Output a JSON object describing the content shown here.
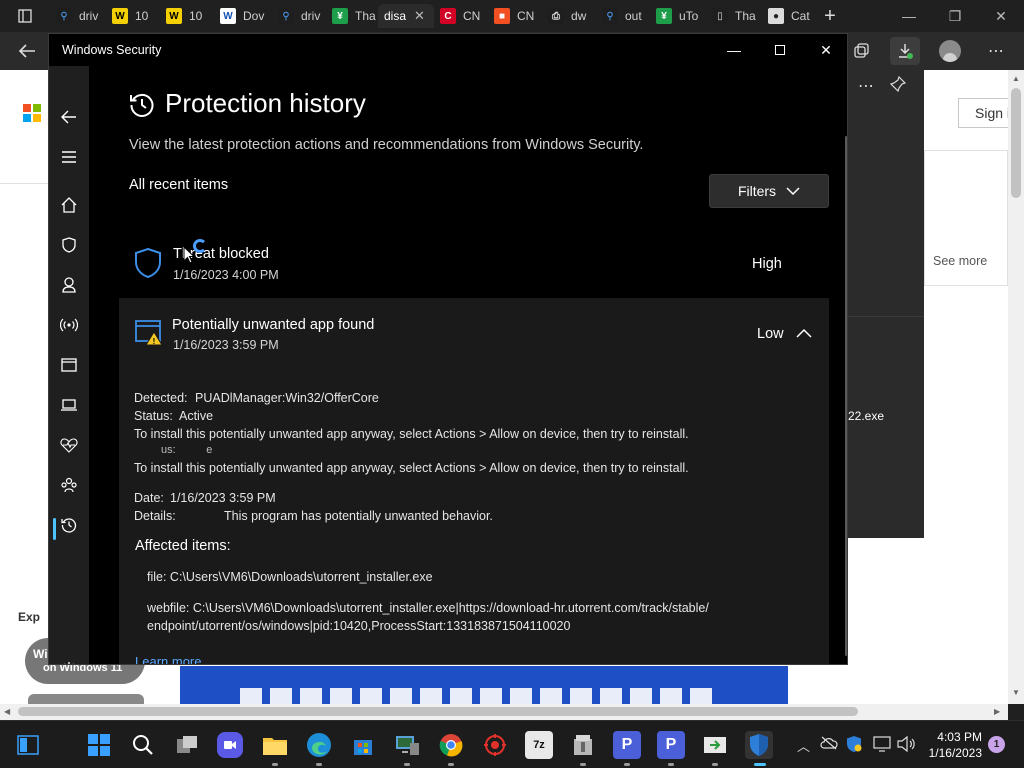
{
  "browser": {
    "tabs": [
      {
        "label": "driv",
        "icon": "search-icon",
        "fav_bg": "#1e1e1e",
        "fav_fg": "#4da3ff",
        "fav_text": "⚲"
      },
      {
        "label": "10",
        "icon": "w-yellow-icon",
        "fav_bg": "#f5d000",
        "fav_fg": "#000",
        "fav_text": "W"
      },
      {
        "label": "10",
        "icon": "w-yellow-icon",
        "fav_bg": "#f5d000",
        "fav_fg": "#000",
        "fav_text": "W"
      },
      {
        "label": "Dov",
        "icon": "w-blue-icon",
        "fav_bg": "#ffffff",
        "fav_fg": "#1352b6",
        "fav_text": "W"
      },
      {
        "label": "driv",
        "icon": "search-icon",
        "fav_bg": "#1e1e1e",
        "fav_fg": "#4da3ff",
        "fav_text": "⚲"
      },
      {
        "label": "Tha",
        "icon": "green-check-icon",
        "fav_bg": "#1e9e4a",
        "fav_fg": "#fff",
        "fav_text": "¥"
      },
      {
        "label": "disa",
        "icon": "",
        "fav_bg": "",
        "fav_fg": "",
        "fav_text": "",
        "active": true
      },
      {
        "label": "CN",
        "icon": "cnet-icon",
        "fav_bg": "#d10024",
        "fav_fg": "#fff",
        "fav_text": "C"
      },
      {
        "label": "CN",
        "icon": "microsoft-icon",
        "fav_bg": "#f25022",
        "fav_fg": "#fff",
        "fav_text": "■"
      },
      {
        "label": "dw",
        "icon": "document-icon",
        "fav_bg": "#1e1e1e",
        "fav_fg": "#ddd",
        "fav_text": "⎙"
      },
      {
        "label": "out",
        "icon": "search-icon",
        "fav_bg": "#1e1e1e",
        "fav_fg": "#4da3ff",
        "fav_text": "⚲"
      },
      {
        "label": "uTo",
        "icon": "green-check-icon",
        "fav_bg": "#1e9e4a",
        "fav_fg": "#fff",
        "fav_text": "¥"
      },
      {
        "label": "Tha",
        "icon": "page-icon",
        "fav_bg": "#1e1e1e",
        "fav_fg": "#ddd",
        "fav_text": "▯"
      },
      {
        "label": "Cat",
        "icon": "cat-icon",
        "fav_bg": "#dcdcdc",
        "fav_fg": "#222",
        "fav_text": "●"
      }
    ]
  },
  "webpage": {
    "sign_in": "Sign i",
    "see_more": "See more",
    "download_name": "22.exe",
    "exp_text": "Exp",
    "pill_text": "Wi",
    "pill_sub": "on Windows 11"
  },
  "ws": {
    "window_title": "Windows Security",
    "page_title": "Protection history",
    "subtitle": "View the latest protection actions and recommendations from Windows Security.",
    "list_header": "All recent items",
    "filters_label": "Filters",
    "items": [
      {
        "title": "Threat blocked",
        "date": "1/16/2023 4:00 PM",
        "severity": "High"
      },
      {
        "title": "Potentially unwanted app found",
        "date": "1/16/2023 3:59 PM",
        "severity": "Low"
      }
    ],
    "details": {
      "detected_label": "Detected:",
      "detected_value": "PUADlManager:Win32/OfferCore",
      "status_label": "Status:",
      "status_value": "Active",
      "advice1": "To install this potentially unwanted app anyway, select Actions > Allow on device, then try to reinstall.",
      "garbled": "us:          e",
      "advice2": "To install this potentially unwanted app anyway, select Actions > Allow on device, then try to reinstall.",
      "date_label": "Date:",
      "date_value": "1/16/2023 3:59 PM",
      "details_label": "Details:",
      "details_value": "This program has potentially unwanted behavior.",
      "affected_header": "Affected items:",
      "file_line": "file: C:\\Users\\VM6\\Downloads\\utorrent_installer.exe",
      "webfile_line1": "webfile: C:\\Users\\VM6\\Downloads\\utorrent_installer.exe|https://download-hr.utorrent.com/track/stable/",
      "webfile_line2": "endpoint/utorrent/os/windows|pid:10420,ProcessStart:133183871504110020",
      "learn_more": "Learn more"
    }
  },
  "taskbar": {
    "time": "4:03 PM",
    "date": "1/16/2023",
    "notification_count": "1"
  },
  "colors": {
    "accent": "#4cc2ff",
    "link": "#5aa9ff",
    "warning": "#f4c724",
    "shield": "#3c8ee8"
  }
}
